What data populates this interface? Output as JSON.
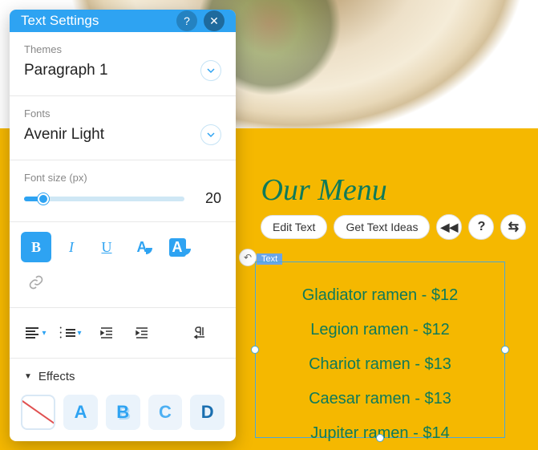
{
  "panel": {
    "title": "Text Settings",
    "themes": {
      "label": "Themes",
      "value": "Paragraph 1"
    },
    "fonts": {
      "label": "Fonts",
      "value": "Avenir Light"
    },
    "fontsize": {
      "label": "Font size (px)",
      "value": "20"
    },
    "format": {
      "bold": "B",
      "italic": "I",
      "underline": "U",
      "color": "A",
      "highlight": "A"
    },
    "effects": {
      "label": "Effects",
      "a": "A",
      "b": "B",
      "c": "C",
      "d": "D"
    }
  },
  "toolbar": {
    "edit_text": "Edit Text",
    "get_ideas": "Get Text Ideas",
    "help": "?"
  },
  "tag": "Text",
  "menu": {
    "title": "Our Menu",
    "items": [
      "Gladiator ramen - $12",
      "Legion ramen - $12",
      "Chariot ramen - $13",
      "Caesar ramen - $13",
      "Jupiter ramen - $14"
    ]
  }
}
